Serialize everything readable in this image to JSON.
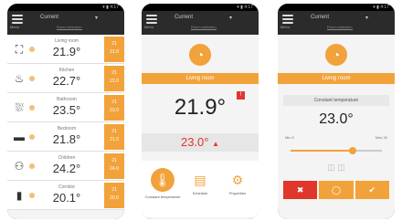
{
  "app": {
    "title": "Current",
    "caret": "▾",
    "subtitle": "Room selection",
    "menu_label": "Menu",
    "status": "▾ ▮ 4:17"
  },
  "rooms": [
    {
      "name": "Living room",
      "temp": "21.9°",
      "icon": "sofa-icon",
      "glyph": "⛶",
      "badge_top": "21",
      "badge_bot": "21.0"
    },
    {
      "name": "Kitchen",
      "temp": "22.7°",
      "icon": "kitchen-icon",
      "glyph": "♨",
      "badge_top": "21",
      "badge_bot": "22.0"
    },
    {
      "name": "Bathroom",
      "temp": "23.5°",
      "icon": "bath-icon",
      "glyph": "⛆",
      "badge_top": "21",
      "badge_bot": "23.0"
    },
    {
      "name": "Bedroom",
      "temp": "21.8°",
      "icon": "bed-icon",
      "glyph": "▬",
      "badge_top": "21",
      "badge_bot": "21.0"
    },
    {
      "name": "Children",
      "temp": "24.2°",
      "icon": "children-icon",
      "glyph": "⚇",
      "badge_top": "21",
      "badge_bot": "24.0"
    },
    {
      "name": "Corridor",
      "temp": "20.1°",
      "icon": "door-icon",
      "glyph": "▮",
      "badge_top": "21",
      "badge_bot": "20.0"
    }
  ],
  "detail": {
    "room": "Living room",
    "temp": "21.9°",
    "setpoint": "23.0°",
    "setpoint_icon": "▲",
    "actions": [
      {
        "label": "Constant temperature"
      },
      {
        "label": "Schedule"
      },
      {
        "label": "Properties"
      }
    ]
  },
  "setting": {
    "room": "Living room",
    "section_title": "Constant temperature",
    "value": "23.0°",
    "min_label": "Min 5",
    "max_label": "Max 30",
    "slider_fraction": 0.68,
    "mini_icons": "◫ ◫",
    "buttons": [
      "✖",
      "◯",
      "✔"
    ]
  },
  "colors": {
    "accent": "#f2a23a",
    "alert": "#e0362c"
  }
}
